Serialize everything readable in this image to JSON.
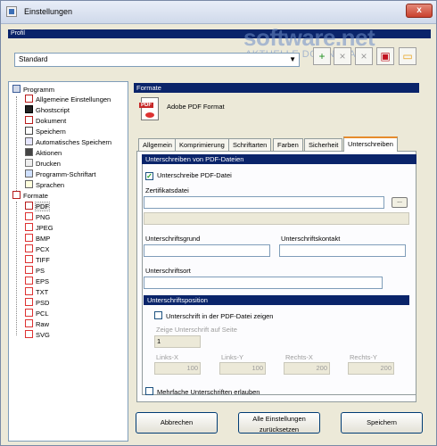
{
  "window": {
    "title": "Einstellungen",
    "close_label": "x"
  },
  "profile": {
    "bar_label": "Profil",
    "selected": "Standard"
  },
  "watermark": {
    "line1": "software.net",
    "line2": "AKTUELLE DOWNLOADS"
  },
  "toolbar": {
    "icons": [
      "add-icon",
      "remove-icon",
      "delete-icon",
      "save-icon",
      "folder-icon"
    ],
    "glyphs": [
      "+",
      "×",
      "×",
      "▣",
      "▭"
    ]
  },
  "tree": {
    "root": "Programm",
    "programm_items": [
      "Allgemeine Einstellungen",
      "Ghostscript",
      "Dokument",
      "Speichern",
      "Automatisches Speichern",
      "Aktionen",
      "Drucken",
      "Programm-Schriftart",
      "Sprachen"
    ],
    "formate": "Formate",
    "formate_items": [
      "PDF",
      "PNG",
      "JPEG",
      "BMP",
      "PCX",
      "TIFF",
      "PS",
      "EPS",
      "TXT",
      "PSD",
      "PCL",
      "Raw",
      "SVG"
    ],
    "selected": "PDF"
  },
  "formate_header": "Formate",
  "format_name": "Adobe PDF Format",
  "tabs": [
    "Allgemein",
    "Komprimierung",
    "Schriftarten",
    "Farben",
    "Sicherheit",
    "Unterschreiben"
  ],
  "active_tab": "Unterschreiben",
  "sign": {
    "section_title": "Unterschreiben von PDF-Dateien",
    "sign_checkbox": "Unterschreibe PDF-Datei",
    "cert_label": "Zertifikatsdatei",
    "cert_value": "",
    "browse_label": "...",
    "reason_label": "Unterschriftsgrund",
    "contact_label": "Unterschriftskontakt",
    "location_label": "Unterschriftsort"
  },
  "position": {
    "title": "Unterschriftsposition",
    "show_checkbox": "Unterschrift in der PDF-Datei zeigen",
    "page_label": "Zeige Unterschrift auf Seite",
    "page_value": "1",
    "links_x_label": "Links-X",
    "links_x_value": "100",
    "links_y_label": "Links-Y",
    "links_y_value": "100",
    "rechts_x_label": "Rechts-X",
    "rechts_x_value": "200",
    "rechts_y_label": "Rechts-Y",
    "rechts_y_value": "200"
  },
  "multi_checkbox": "Mehrfache Unterschriften erlauben",
  "buttons": {
    "cancel": "Abbrechen",
    "reset_line1": "Alle Einstellungen",
    "reset_line2": "zurücksetzen",
    "save": "Speichern"
  }
}
